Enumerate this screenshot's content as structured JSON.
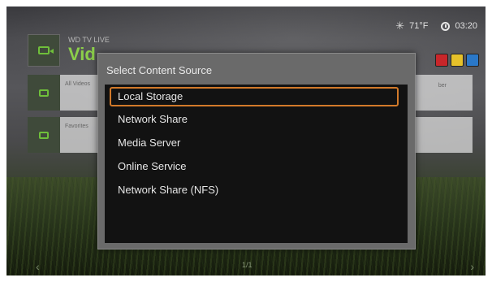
{
  "status_bar": {
    "weather_icon": "sun-icon",
    "temperature": "71°F",
    "clock_icon": "clock-icon",
    "time": "03:20"
  },
  "background": {
    "brand": "WD TV LIVE",
    "section_title": "Vid",
    "color_keys": [
      "#c8262a",
      "#e6c12a",
      "#2a78c8"
    ],
    "rows": [
      {
        "label": "All Videos",
        "right_label": "ber"
      },
      {
        "label": "Favorites",
        "right_label": ""
      }
    ],
    "page_indicator": "1/1"
  },
  "dialog": {
    "title": "Select Content Source",
    "options": [
      "Local Storage",
      "Network Share",
      "Media Server",
      "Online Service",
      "Network Share (NFS)"
    ],
    "selected_index": 0,
    "highlight_color": "#d27a2a"
  }
}
